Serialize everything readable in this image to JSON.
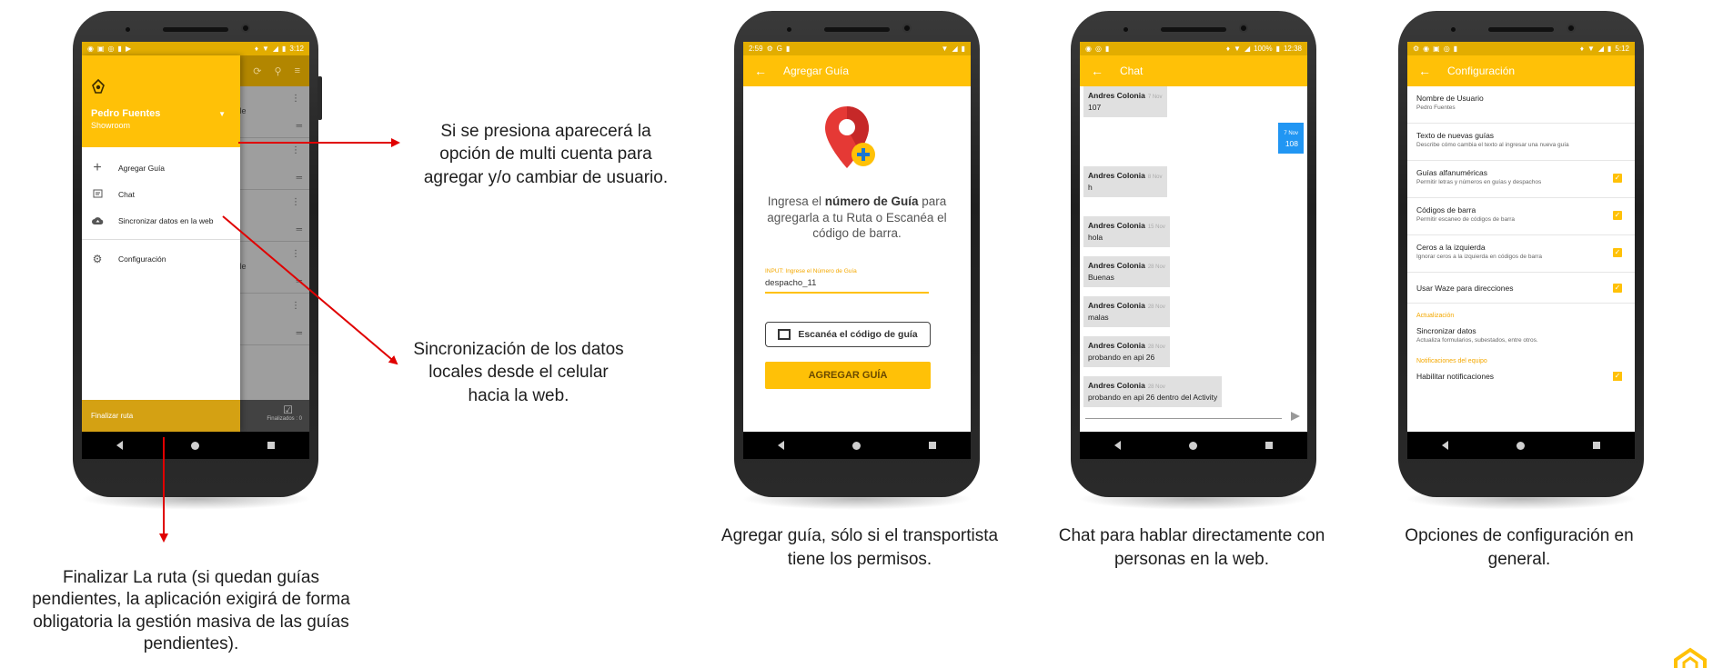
{
  "colors": {
    "brand_yellow": "#ffc107",
    "dark_yellow": "#d4a113",
    "arrow_red": "#e00000",
    "chat_blue": "#2196f3"
  },
  "phone1": {
    "status": {
      "time": "3:12"
    },
    "drawer": {
      "user_name": "Pedro Fuentes",
      "org": "Showroom",
      "items": [
        {
          "label": "Agregar Guía",
          "icon": "plus-icon"
        },
        {
          "label": "Chat",
          "icon": "chat-icon"
        },
        {
          "label": "Sincronizar datos en la web",
          "icon": "cloud-upload-icon"
        },
        {
          "label": "Configuración",
          "icon": "gear-icon"
        }
      ],
      "footer": "Finalizar ruta"
    },
    "background_rows": [
      "Chile",
      "",
      "",
      "Chile",
      ""
    ],
    "background_footer": "Finalizados : 0"
  },
  "annotations": {
    "multi_account": "Si se presiona aparecerá la opción de multi cuenta para agregar y/o cambiar de usuario.",
    "sync": "Sincronización de los datos locales desde el celular hacia la web.",
    "finalize": "Finalizar La ruta (si quedan guías pendientes, la aplicación exigirá de forma obligatoria la gestión masiva de las guías pendientes)."
  },
  "phone2": {
    "status": {
      "time": "2:59"
    },
    "appbar_title": "Agregar Guía",
    "instruction_pre": "Ingresa el ",
    "instruction_bold": "número de Guía",
    "instruction_post": " para agregarla a tu Ruta o Escanéa el código de barra.",
    "input_label": "INPUT: Ingrese el Número de Guía",
    "input_value": "despacho_11",
    "scan_button": "Escanéa el código de guía",
    "add_button": "AGREGAR GUÍA",
    "caption": "Agregar guía, sólo si el transportista tiene los permisos."
  },
  "phone3": {
    "status": {
      "time": "12:38",
      "battery": "100%"
    },
    "appbar_title": "Chat",
    "messages": [
      {
        "author": "Andres Colonia",
        "date": "7 Nov",
        "text": "107"
      },
      {
        "author": "Andres Colonia",
        "date": "8 Nov",
        "text": "h"
      },
      {
        "author": "Andres Colonia",
        "date": "15 Nov",
        "text": "hola"
      },
      {
        "author": "Andres Colonia",
        "date": "28 Nov",
        "text": "Buenas"
      },
      {
        "author": "Andres Colonia",
        "date": "28 Nov",
        "text": "malas"
      },
      {
        "author": "Andres Colonia",
        "date": "28 Nov",
        "text": "probando en api 26"
      },
      {
        "author": "Andres Colonia",
        "date": "28 Nov",
        "text": "probando en api 26 dentro del Activity"
      }
    ],
    "my_message": {
      "date": "7 Nov",
      "text": "108"
    },
    "caption": "Chat para hablar directamente con personas en la web."
  },
  "phone4": {
    "status": {
      "time": "5:12"
    },
    "appbar_title": "Configuración",
    "items": [
      {
        "title": "Nombre de Usuario",
        "sub": "Pedro Fuentes",
        "checked": false
      },
      {
        "title": "Texto de nuevas guías",
        "sub": "Describe cómo cambia el texto al ingresar una nueva guía",
        "checked": false
      },
      {
        "title": "Guías alfanuméricas",
        "sub": "Permitir letras y números en guías y despachos",
        "checked": true
      },
      {
        "title": "Códigos de barra",
        "sub": "Permitir escaneo de códigos de barra",
        "checked": true
      },
      {
        "title": "Ceros a la izquierda",
        "sub": "Ignorar ceros a la izquierda en códigos de barra",
        "checked": true
      },
      {
        "title": "Usar Waze para direcciones",
        "sub": "",
        "checked": true
      }
    ],
    "section_update": "Actualización",
    "sync_title": "Sincronizar datos",
    "sync_sub": "Actualiza formularios, subestados, entre otros.",
    "section_team": "Notificaciones del equipo",
    "team_item": "Habilitar notificaciones",
    "caption": "Opciones de configuración en general."
  }
}
